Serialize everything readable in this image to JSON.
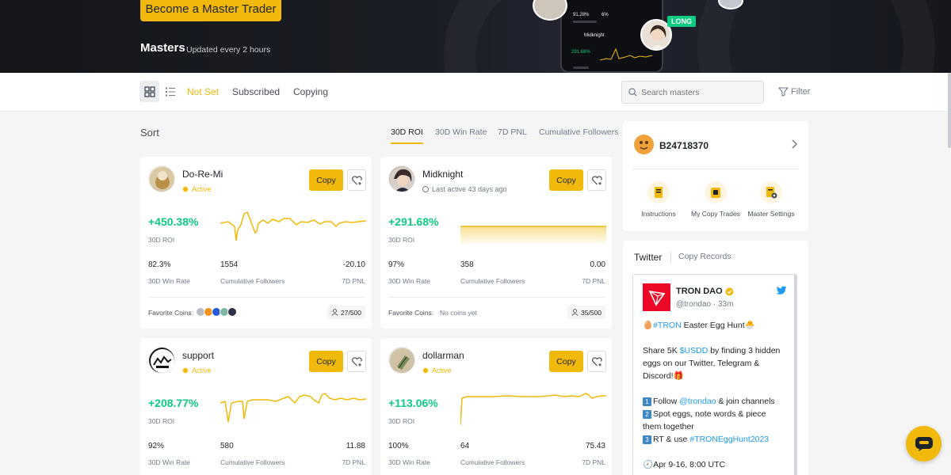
{
  "hero": {
    "cta_label": "Become a Master Trader",
    "title": "Masters",
    "subtitle": "Updated every 2 hours",
    "badge": "LONG",
    "phone": {
      "name": "Midknight",
      "roi": "291.68%",
      "pct1": "91.28%",
      "pct2": "6%"
    }
  },
  "toolbar": {
    "tabs": [
      "Not Set",
      "Subscribed",
      "Copying"
    ],
    "search_placeholder": "Search masters",
    "filter_label": "Filter"
  },
  "sort": {
    "label": "Sort",
    "options": [
      "30D ROI",
      "30D Win Rate",
      "7D PNL",
      "Cumulative Followers"
    ]
  },
  "cards": [
    {
      "name": "Do-Re-Mi",
      "status": "Active",
      "roi": "+450.38%",
      "roi_label": "30D ROI",
      "win_rate": "82.3%",
      "followers": "1554",
      "pnl": "-20.10",
      "win_label": "30D Win Rate",
      "followers_label": "Cumulative Followers",
      "pnl_label": "7D PNL",
      "fav_label": "Favorite Coins:",
      "capacity": "27/500",
      "copy_label": "Copy"
    },
    {
      "name": "Midknight",
      "status": "Last active 43 days ago",
      "roi": "+291.68%",
      "roi_label": "30D ROI",
      "win_rate": "97%",
      "followers": "358",
      "pnl": "0.00",
      "win_label": "30D Win Rate",
      "followers_label": "Cumulative Followers",
      "pnl_label": "7D PNL",
      "fav_label": "Favorite Coins:",
      "no_coins": "No coins yet",
      "capacity": "35/500",
      "copy_label": "Copy"
    },
    {
      "name": "support",
      "status": "Active",
      "roi": "+208.77%",
      "roi_label": "30D ROI",
      "win_rate": "92%",
      "followers": "580",
      "pnl": "11.88",
      "win_label": "30D Win Rate",
      "followers_label": "Cumulative Followers",
      "pnl_label": "7D PNL",
      "copy_label": "Copy"
    },
    {
      "name": "dollarman",
      "status": "Active",
      "roi": "+113.06%",
      "roi_label": "30D ROI",
      "win_rate": "100%",
      "followers": "64",
      "pnl": "75.43",
      "win_label": "30D Win Rate",
      "followers_label": "Cumulative Followers",
      "pnl_label": "7D PNL",
      "copy_label": "Copy"
    }
  ],
  "profile": {
    "username": "B24718370",
    "actions": [
      "Instructions",
      "My Copy Trades",
      "Master Settings"
    ]
  },
  "twitter": {
    "tab_active": "Twitter",
    "tab_other": "Copy Records",
    "account": "TRON DAO",
    "handle": "@trondao · 33m",
    "l1_tag": "#TRON",
    "l1_text": " Easter Egg Hunt",
    "l2_a": "Share 5K ",
    "l2_tag": "$USDD",
    "l2_b": " by finding 3 hidden eggs on our Twitter, Telegram & Discord!",
    "s1_a": "Follow ",
    "s1_tag": "@trondao",
    "s1_b": " & join channels",
    "s2": "Spot eggs, note words & piece them together",
    "s3_a": "RT & use ",
    "s3_tag": "#TRONEggHunt2023",
    "date": "Apr 9-16, 8:00 UTC"
  },
  "colors": {
    "brand": "#f0b90b",
    "positive": "#0ecb81",
    "link": "#1d9bf0",
    "tron": "#ec0928"
  }
}
